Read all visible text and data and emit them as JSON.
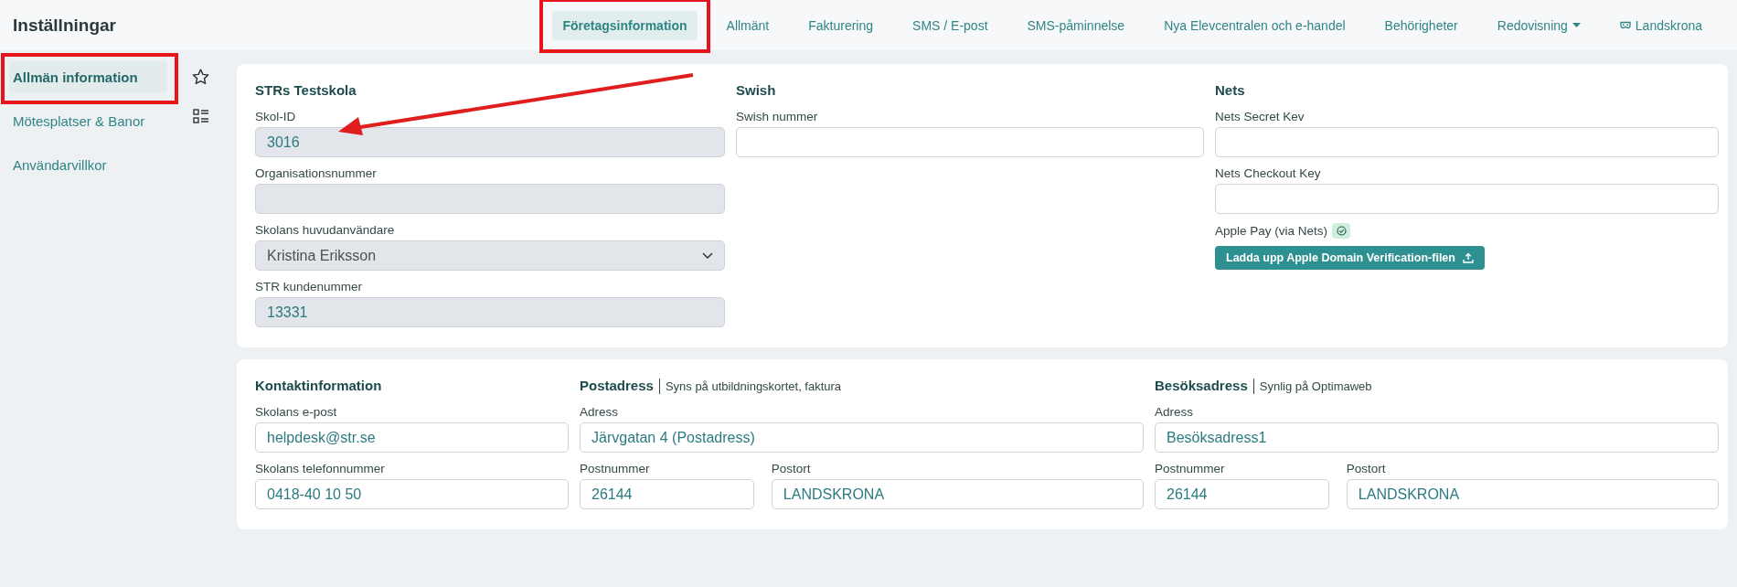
{
  "header": {
    "title": "Inställningar"
  },
  "tabs": [
    {
      "label": "Företagsinformation",
      "kind": "tab",
      "selected": true,
      "highlighted": true
    },
    {
      "label": "Allmänt",
      "kind": "tab",
      "selected": false,
      "highlighted": false
    },
    {
      "label": "Fakturering",
      "kind": "tab",
      "selected": false,
      "highlighted": false
    },
    {
      "label": "SMS / E-post",
      "kind": "tab",
      "selected": false,
      "highlighted": false
    },
    {
      "label": "SMS-påminnelse",
      "kind": "tab",
      "selected": false,
      "highlighted": false
    },
    {
      "label": "Nya Elevcentralen och e-handel",
      "kind": "tab",
      "selected": false,
      "highlighted": false
    },
    {
      "label": "Behörigheter",
      "kind": "tab",
      "selected": false,
      "highlighted": false
    },
    {
      "label": "Redovisning",
      "kind": "dropdown",
      "selected": false,
      "highlighted": false
    },
    {
      "label": "Landskrona",
      "kind": "location",
      "selected": false,
      "highlighted": false
    }
  ],
  "sidebar": {
    "items": [
      {
        "label": "Allmän information",
        "selected": true,
        "highlighted": true
      },
      {
        "label": "Mötesplatser & Banor",
        "selected": false,
        "highlighted": false
      },
      {
        "label": "Användarvillkor",
        "selected": false,
        "highlighted": false
      }
    ]
  },
  "company_card": {
    "sections": [
      {
        "title": "STRs Testskola",
        "rows": [
          [
            {
              "label": "Skol-ID",
              "kind": "text",
              "value": "3016",
              "disabled": true,
              "pointed_at": true
            }
          ],
          [
            {
              "label": "Organisationsnummer",
              "kind": "text",
              "disabled": true
            }
          ],
          [
            {
              "label": "Skolans huvudanvändare",
              "kind": "select",
              "value": "Kristina Eriksson",
              "disabled": true
            }
          ],
          [
            {
              "label": "STR kundenummer",
              "kind": "text",
              "value": "13331",
              "disabled": true
            }
          ]
        ]
      },
      {
        "title": "Swish",
        "rows": [
          [
            {
              "label": "Swish nummer",
              "kind": "text",
              "disabled": false
            }
          ]
        ]
      },
      {
        "title": "Nets",
        "rows": [
          [
            {
              "label": "Nets Secret Kev",
              "kind": "text",
              "disabled": false
            }
          ],
          [
            {
              "label": "Nets Checkout Key",
              "kind": "text",
              "disabled": false
            }
          ]
        ],
        "apple_pay": {
          "label": "Apple Pay (via Nets)",
          "verified": true
        },
        "upload_button": "Ladda upp Apple Domain Verification-filen"
      }
    ]
  },
  "contact_card": {
    "sections": [
      {
        "title": "Kontaktinformation",
        "rows": [
          [
            {
              "label": "Skolans e-post",
              "kind": "text",
              "value": "helpdesk@str.se",
              "disabled": false
            }
          ],
          [
            {
              "label": "Skolans telefonnummer",
              "kind": "text",
              "value": "0418-40 10 50",
              "disabled": false
            }
          ]
        ]
      },
      {
        "title": "Postadress",
        "subtitle": "Syns på utbildningskortet, faktura",
        "rows": [
          [
            {
              "label": "Adress",
              "kind": "text",
              "value": "Järvgatan 4 (Postadress)",
              "disabled": false
            }
          ],
          [
            {
              "label": "Postnummer",
              "kind": "text",
              "value": "26144",
              "disabled": false
            },
            {
              "label": "Postort",
              "kind": "text",
              "value": "LANDSKRONA",
              "disabled": false
            }
          ]
        ]
      },
      {
        "title": "Besöksadress",
        "subtitle": "Synlig på Optimaweb",
        "rows": [
          [
            {
              "label": "Adress",
              "kind": "text",
              "value": "Besöksadress1",
              "disabled": false
            }
          ],
          [
            {
              "label": "Postnummer",
              "kind": "text",
              "value": "26144",
              "disabled": false
            },
            {
              "label": "Postort",
              "kind": "text",
              "value": "LANDSKRONA",
              "disabled": false
            }
          ]
        ]
      }
    ]
  }
}
